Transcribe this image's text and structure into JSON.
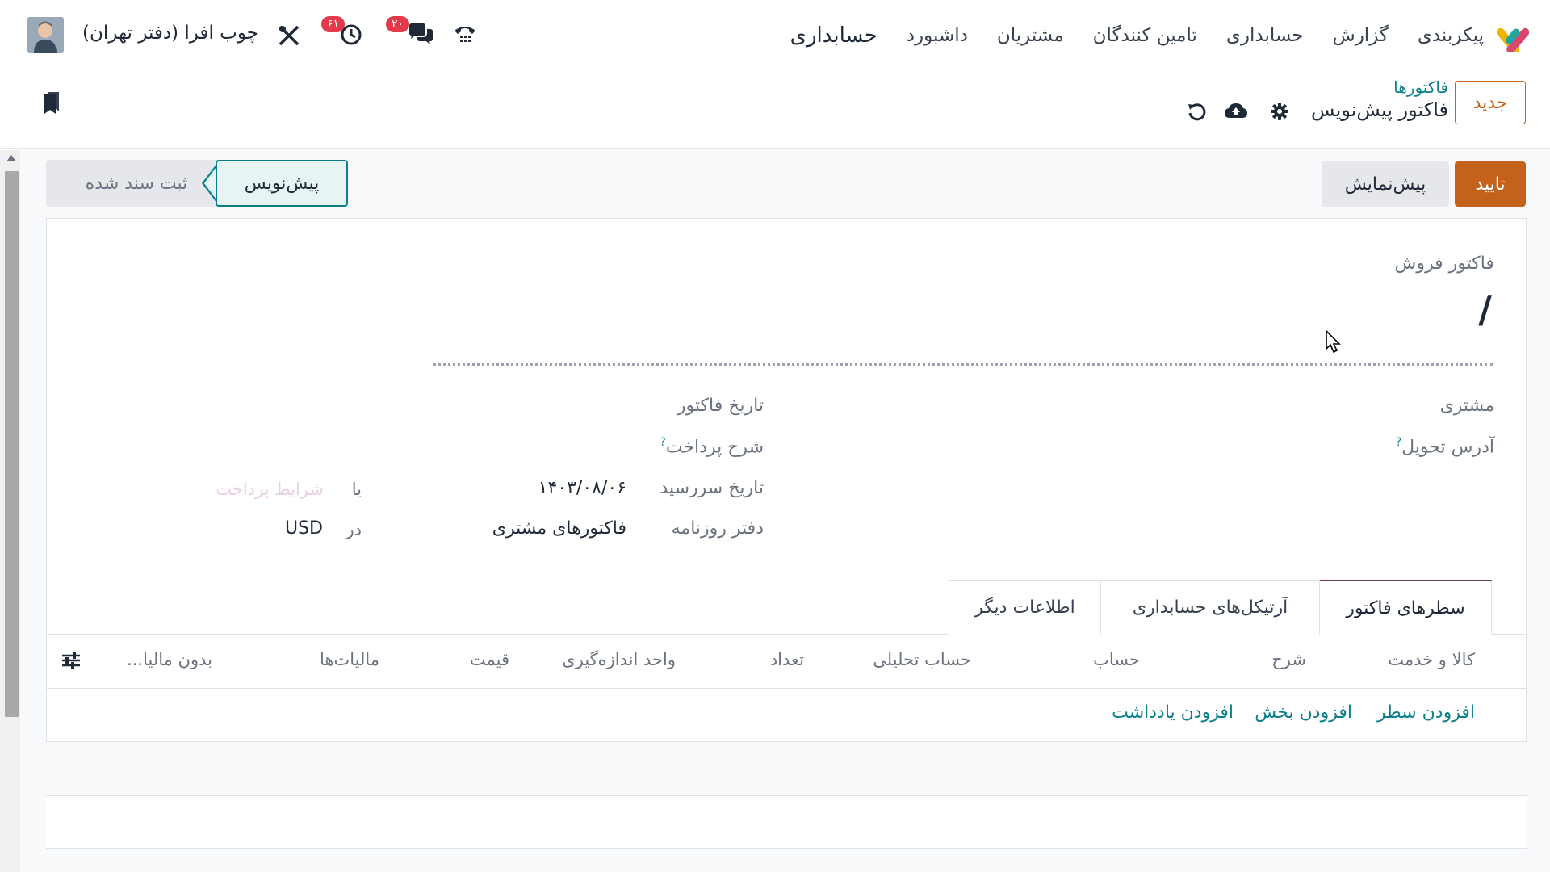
{
  "navbar": {
    "brand": "حسابداری",
    "menu": [
      "داشبورد",
      "مشتریان",
      "تامین کنندگان",
      "حسابداری",
      "گزارش",
      "پیکربندی"
    ],
    "company": "چوب افرا (دفتر تهران)",
    "messages_count": "۲۰",
    "activities_count": "۶۱"
  },
  "control_panel": {
    "new_button": "جدید",
    "breadcrumb_parent": "فاکتورها",
    "breadcrumb_current": "فاکتور پیش‌نویس"
  },
  "actions": {
    "confirm": "تایید",
    "preview": "پیش‌نمایش"
  },
  "status": {
    "draft": "پیش‌نویس",
    "posted": "ثبت سند شده"
  },
  "form": {
    "move_type": "فاکتور فروش",
    "name": "/",
    "customer_label": "مشتری",
    "delivery_address_label": "آدرس تحویل",
    "question_mark": "?",
    "invoice_date_label": "تاریخ فاکتور",
    "payment_reference_label": "شرح پرداخت",
    "due_date_label": "تاریخ سررسید",
    "due_date_value": "۱۴۰۳/۰۸/۰۶",
    "or_label": "یا",
    "payment_terms_placeholder": "شرایط پرداخت",
    "journal_label": "دفتر روزنامه",
    "journal_value": "فاکتورهای مشتری",
    "in_label": "در",
    "currency_value": "USD"
  },
  "tabs": [
    "سطرهای فاکتور",
    "آرتیکل‌های حسابداری",
    "اطلاعات دیگر"
  ],
  "lines_table": {
    "columns": [
      "کالا و خدمت",
      "شرح",
      "حساب",
      "حساب تحلیلی",
      "تعداد",
      "واحد اندازه‌گیری",
      "قیمت",
      "مالیات‌ها",
      "بدون مالیا..."
    ],
    "add_line": "افزودن سطر",
    "add_section": "افزودن بخش",
    "add_note": "افزودن یادداشت"
  },
  "colors": {
    "primary": "#c4621c",
    "link": "#0c7f8a",
    "active_tab": "#6b3a5c",
    "badge": "#e5384a"
  }
}
